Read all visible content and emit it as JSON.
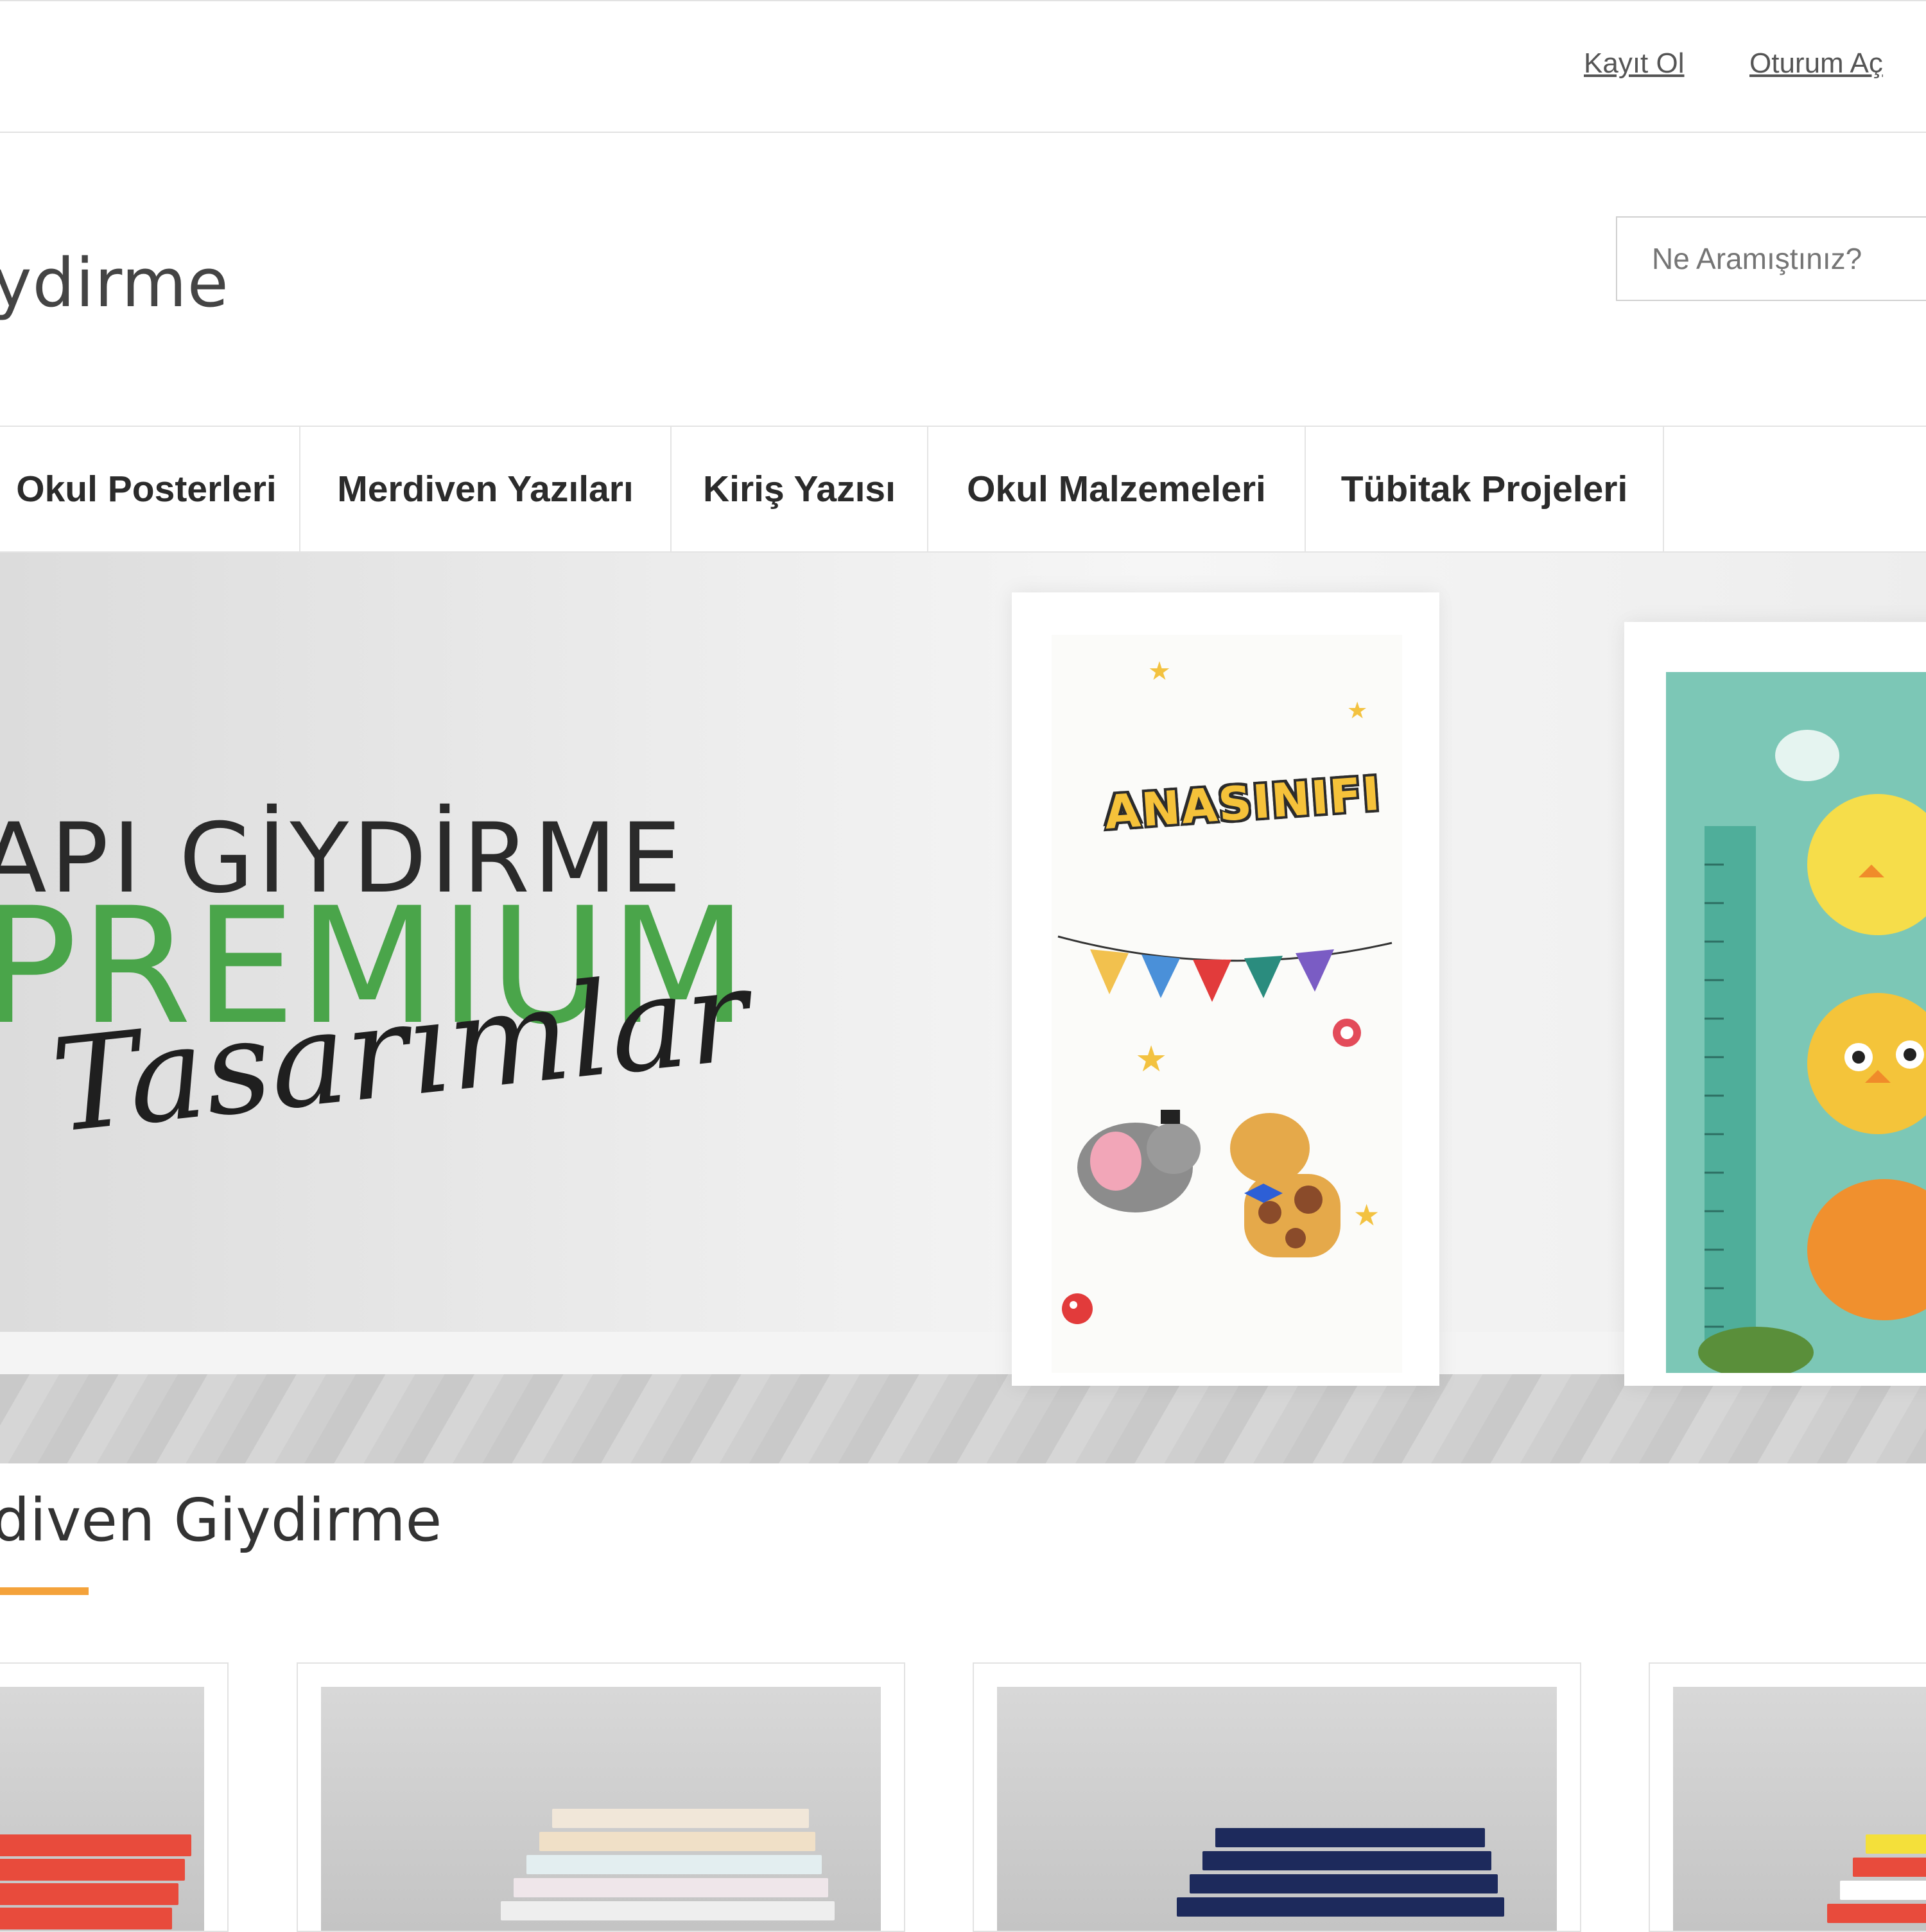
{
  "topbar": {
    "register_label": "Kayıt Ol",
    "login_label": "Oturum Aç"
  },
  "header": {
    "logo_text": "ydirme",
    "search_placeholder": "Ne Aramıştınız?"
  },
  "nav": {
    "items": [
      {
        "label": "Okul Posterleri"
      },
      {
        "label": "Merdiven Yazıları"
      },
      {
        "label": "Kiriş Yazısı"
      },
      {
        "label": "Okul Malzemeleri"
      },
      {
        "label": "Tübitak Projeleri"
      }
    ]
  },
  "hero": {
    "line1": "API GİYDİRME",
    "line2": "PREMIUM",
    "line3": "Tasarımlar",
    "door_title": "ANASINIFI"
  },
  "section": {
    "title": "diven Giydirme"
  },
  "colors": {
    "accent_green": "#4aa54a",
    "underline_orange": "#f4a23a"
  }
}
